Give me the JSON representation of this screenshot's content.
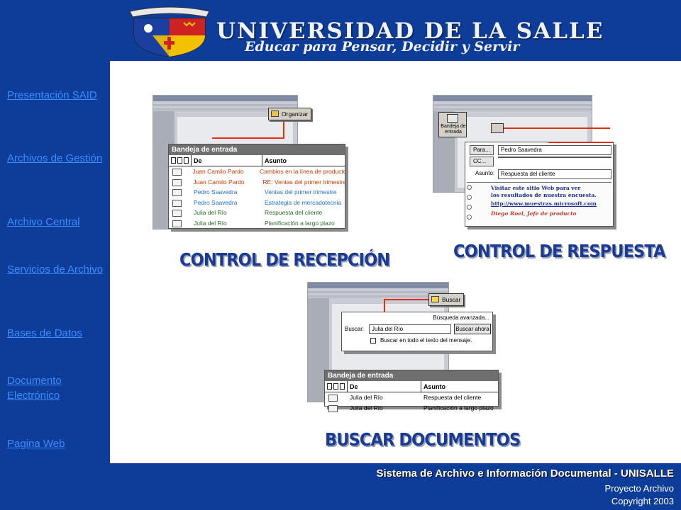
{
  "header": {
    "title": "UNIVERSIDAD DE LA SALLE",
    "motto": "Educar para Pensar, Decidir y Servir",
    "colors": {
      "background": "#0d3d99",
      "text": "#f2f2f2",
      "crest_red": "#cc2222",
      "crest_yellow": "#f2c200"
    }
  },
  "sidebar": {
    "items": [
      {
        "label": "Presentación SAID"
      },
      {
        "label": "Archivos de Gestión"
      },
      {
        "label": "Archivo Central"
      },
      {
        "label": "Servicios de Archivo"
      },
      {
        "label": "Bases de Datos"
      },
      {
        "label": "Documento Electrónico"
      },
      {
        "label": "Pagina Web"
      }
    ],
    "link_color": "#3b8dff"
  },
  "recepcion": {
    "callout": "Organizar",
    "panel_title": "Bandeja de entrada",
    "columns": {
      "de": "De",
      "asunto": "Asunto"
    },
    "rows": [
      {
        "de": "Juan Camilo Pardo",
        "asunto": "Cambios en la línea de productos",
        "color": "#d23a00"
      },
      {
        "de": "Juan Camilo Pardo",
        "asunto": "RE: Ventas del primer trimestre",
        "color": "#d23a00"
      },
      {
        "de": "Pedro Saavedra",
        "asunto": "Ventas del primer trimestre",
        "color": "#1f6fd1"
      },
      {
        "de": "Pedro Saavedra",
        "asunto": "Estrategia de mercadotecnia",
        "color": "#1f6fd1"
      },
      {
        "de": "Julia del Río",
        "asunto": "Respuesta del cliente",
        "color": "#2b6b2b"
      },
      {
        "de": "Julia del Río",
        "asunto": "Planificación a largo plazo",
        "color": "#2b6b2b"
      }
    ],
    "caption": "CONTROL DE RECEPCIÓN"
  },
  "respuesta": {
    "inbox_icon_label": "Bandeja de entrada",
    "para_label": "Para...",
    "para_value": "Pedro Saavedra",
    "cc_label": "CC...",
    "asunto_label": "Asunto:",
    "asunto_value": "Respuesta del cliente",
    "message_lines": [
      "Visitar este sitio Web para ver",
      "los resultados de nuestra encuesta.",
      "http://www.muestras.microsoft.com",
      "Diego Roel, Jefe de producto"
    ],
    "caption": "CONTROL DE RESPUESTA"
  },
  "buscar": {
    "callout": "Buscar",
    "advanced_label": "Búsqueda avanzada...",
    "search_label": "Buscar:",
    "search_value": "Julia del Río",
    "search_button": "Buscar ahora",
    "checkbox_label": "Buscar en todo el texto del mensaje.",
    "panel_title": "Bandeja de entrada",
    "columns": {
      "de": "De",
      "asunto": "Asunto"
    },
    "rows": [
      {
        "de": "Julia del Río",
        "asunto": "Respuesta del cliente"
      },
      {
        "de": "Julia del Río",
        "asunto": "Planificación a largo plazo"
      }
    ],
    "caption": "BUSCAR DOCUMENTOS"
  },
  "footer": {
    "title": "Sistema de Archivo e Información Documental - UNISALLE",
    "project": "Proyecto Archivo",
    "copyright": "Copyright 2003"
  }
}
